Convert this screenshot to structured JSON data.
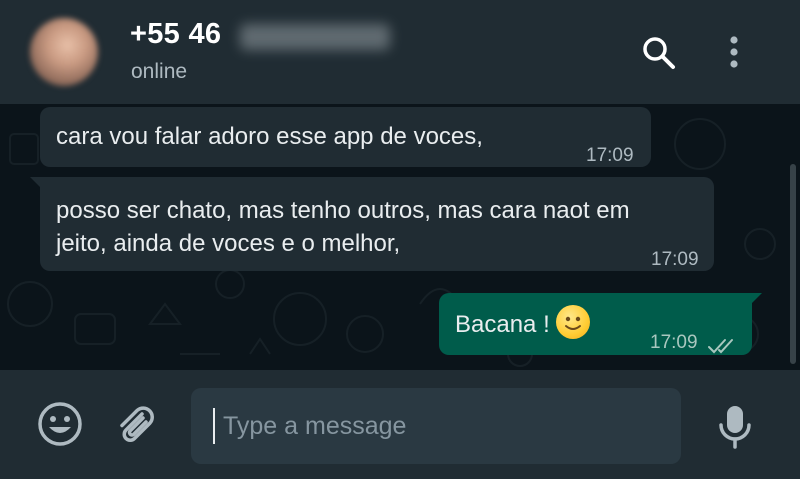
{
  "header": {
    "contact_name": "+55 46",
    "status": "online",
    "search_icon": "search-icon",
    "menu_icon": "kebab-menu-icon"
  },
  "messages": [
    {
      "direction": "incoming",
      "text": "cara vou falar adoro esse app de voces,",
      "time": "17:09"
    },
    {
      "direction": "incoming",
      "text_line1": "posso ser chato, mas tenho outros, mas cara naot em",
      "text_line2": "jeito, ainda de voces e o melhor,",
      "time": "17:09"
    },
    {
      "direction": "outgoing",
      "text": "Bacana !",
      "emoji": "slightly-smiling-face",
      "time": "17:09",
      "read_status": "double-check-icon"
    }
  ],
  "composer": {
    "placeholder": "Type a message",
    "emoji_icon": "emoji-icon",
    "attach_icon": "paperclip-icon",
    "mic_icon": "microphone-icon"
  },
  "colors": {
    "header_bg": "#202c33",
    "chat_bg": "#0b141a",
    "incoming_bubble": "#202c33",
    "outgoing_bubble": "#005c4b",
    "input_bg": "#2a3942"
  }
}
